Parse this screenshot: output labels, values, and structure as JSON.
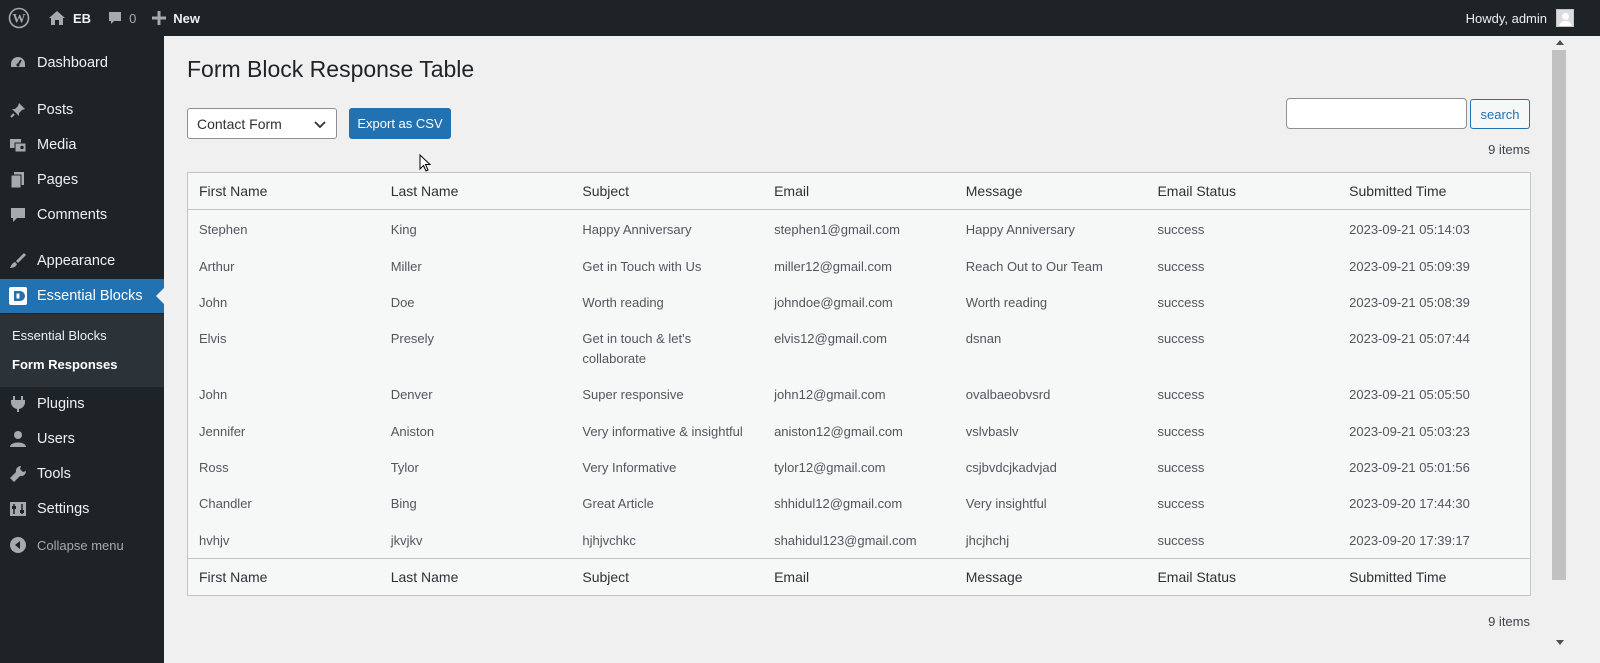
{
  "adminbar": {
    "site_name": "EB",
    "comments_count": "0",
    "new_label": "New",
    "howdy": "Howdy, admin"
  },
  "sidebar": {
    "items": [
      {
        "label": "Dashboard",
        "icon": "dashboard-icon"
      },
      {
        "label": "Posts",
        "icon": "pin-icon"
      },
      {
        "label": "Media",
        "icon": "media-icon"
      },
      {
        "label": "Pages",
        "icon": "pages-icon"
      },
      {
        "label": "Comments",
        "icon": "comment-icon"
      },
      {
        "label": "Appearance",
        "icon": "brush-icon"
      },
      {
        "label": "Essential Blocks",
        "icon": "essential-blocks-icon"
      },
      {
        "label": "Plugins",
        "icon": "plugin-icon"
      },
      {
        "label": "Users",
        "icon": "user-icon"
      },
      {
        "label": "Tools",
        "icon": "wrench-icon"
      },
      {
        "label": "Settings",
        "icon": "settings-icon"
      }
    ],
    "submenu": [
      "Essential Blocks",
      "Form Responses"
    ],
    "collapse_label": "Collapse menu"
  },
  "main": {
    "title": "Form Block Response Table",
    "form_select_value": "Contact Form",
    "export_label": "Export as CSV",
    "search_label": "search",
    "items_count": "9 items"
  },
  "table": {
    "columns": [
      "First Name",
      "Last Name",
      "Subject",
      "Email",
      "Message",
      "Email Status",
      "Submitted Time"
    ],
    "rows": [
      [
        "Stephen",
        "King",
        "Happy Anniversary",
        "stephen1@gmail.com",
        "Happy Anniversary",
        "success",
        "2023-09-21 05:14:03"
      ],
      [
        "Arthur",
        "Miller",
        "Get in Touch with Us",
        "miller12@gmail.com",
        "Reach Out to Our Team",
        "success",
        "2023-09-21 05:09:39"
      ],
      [
        "John",
        "Doe",
        "Worth reading",
        "johndoe@gmail.com",
        "Worth reading",
        "success",
        "2023-09-21 05:08:39"
      ],
      [
        "Elvis",
        "Presely",
        "Get in touch & let's collaborate",
        "elvis12@gmail.com",
        "dsnan",
        "success",
        "2023-09-21 05:07:44"
      ],
      [
        "John",
        "Denver",
        "Super responsive",
        "john12@gmail.com",
        "ovalbaeobvsrd",
        "success",
        "2023-09-21 05:05:50"
      ],
      [
        "Jennifer",
        "Aniston",
        "Very informative & insightful",
        "aniston12@gmail.com",
        "vslvbaslv",
        "success",
        "2023-09-21 05:03:23"
      ],
      [
        "Ross",
        "Tylor",
        "Very Informative",
        "tylor12@gmail.com",
        "csjbvdcjkadvjad",
        "success",
        "2023-09-21 05:01:56"
      ],
      [
        "Chandler",
        "Bing",
        "Great Article",
        "shhidul12@gmail.com",
        "Very insightful",
        "success",
        "2023-09-20 17:44:30"
      ],
      [
        "hvhjv",
        "jkvjkv",
        "hjhjvchkc",
        "shahidul123@gmail.com",
        "jhcjhchj",
        "success",
        "2023-09-20 17:39:17"
      ]
    ]
  },
  "colors": {
    "admin_dark": "#1d2327",
    "accent_blue": "#2271b1",
    "background": "#f0f0f1"
  }
}
